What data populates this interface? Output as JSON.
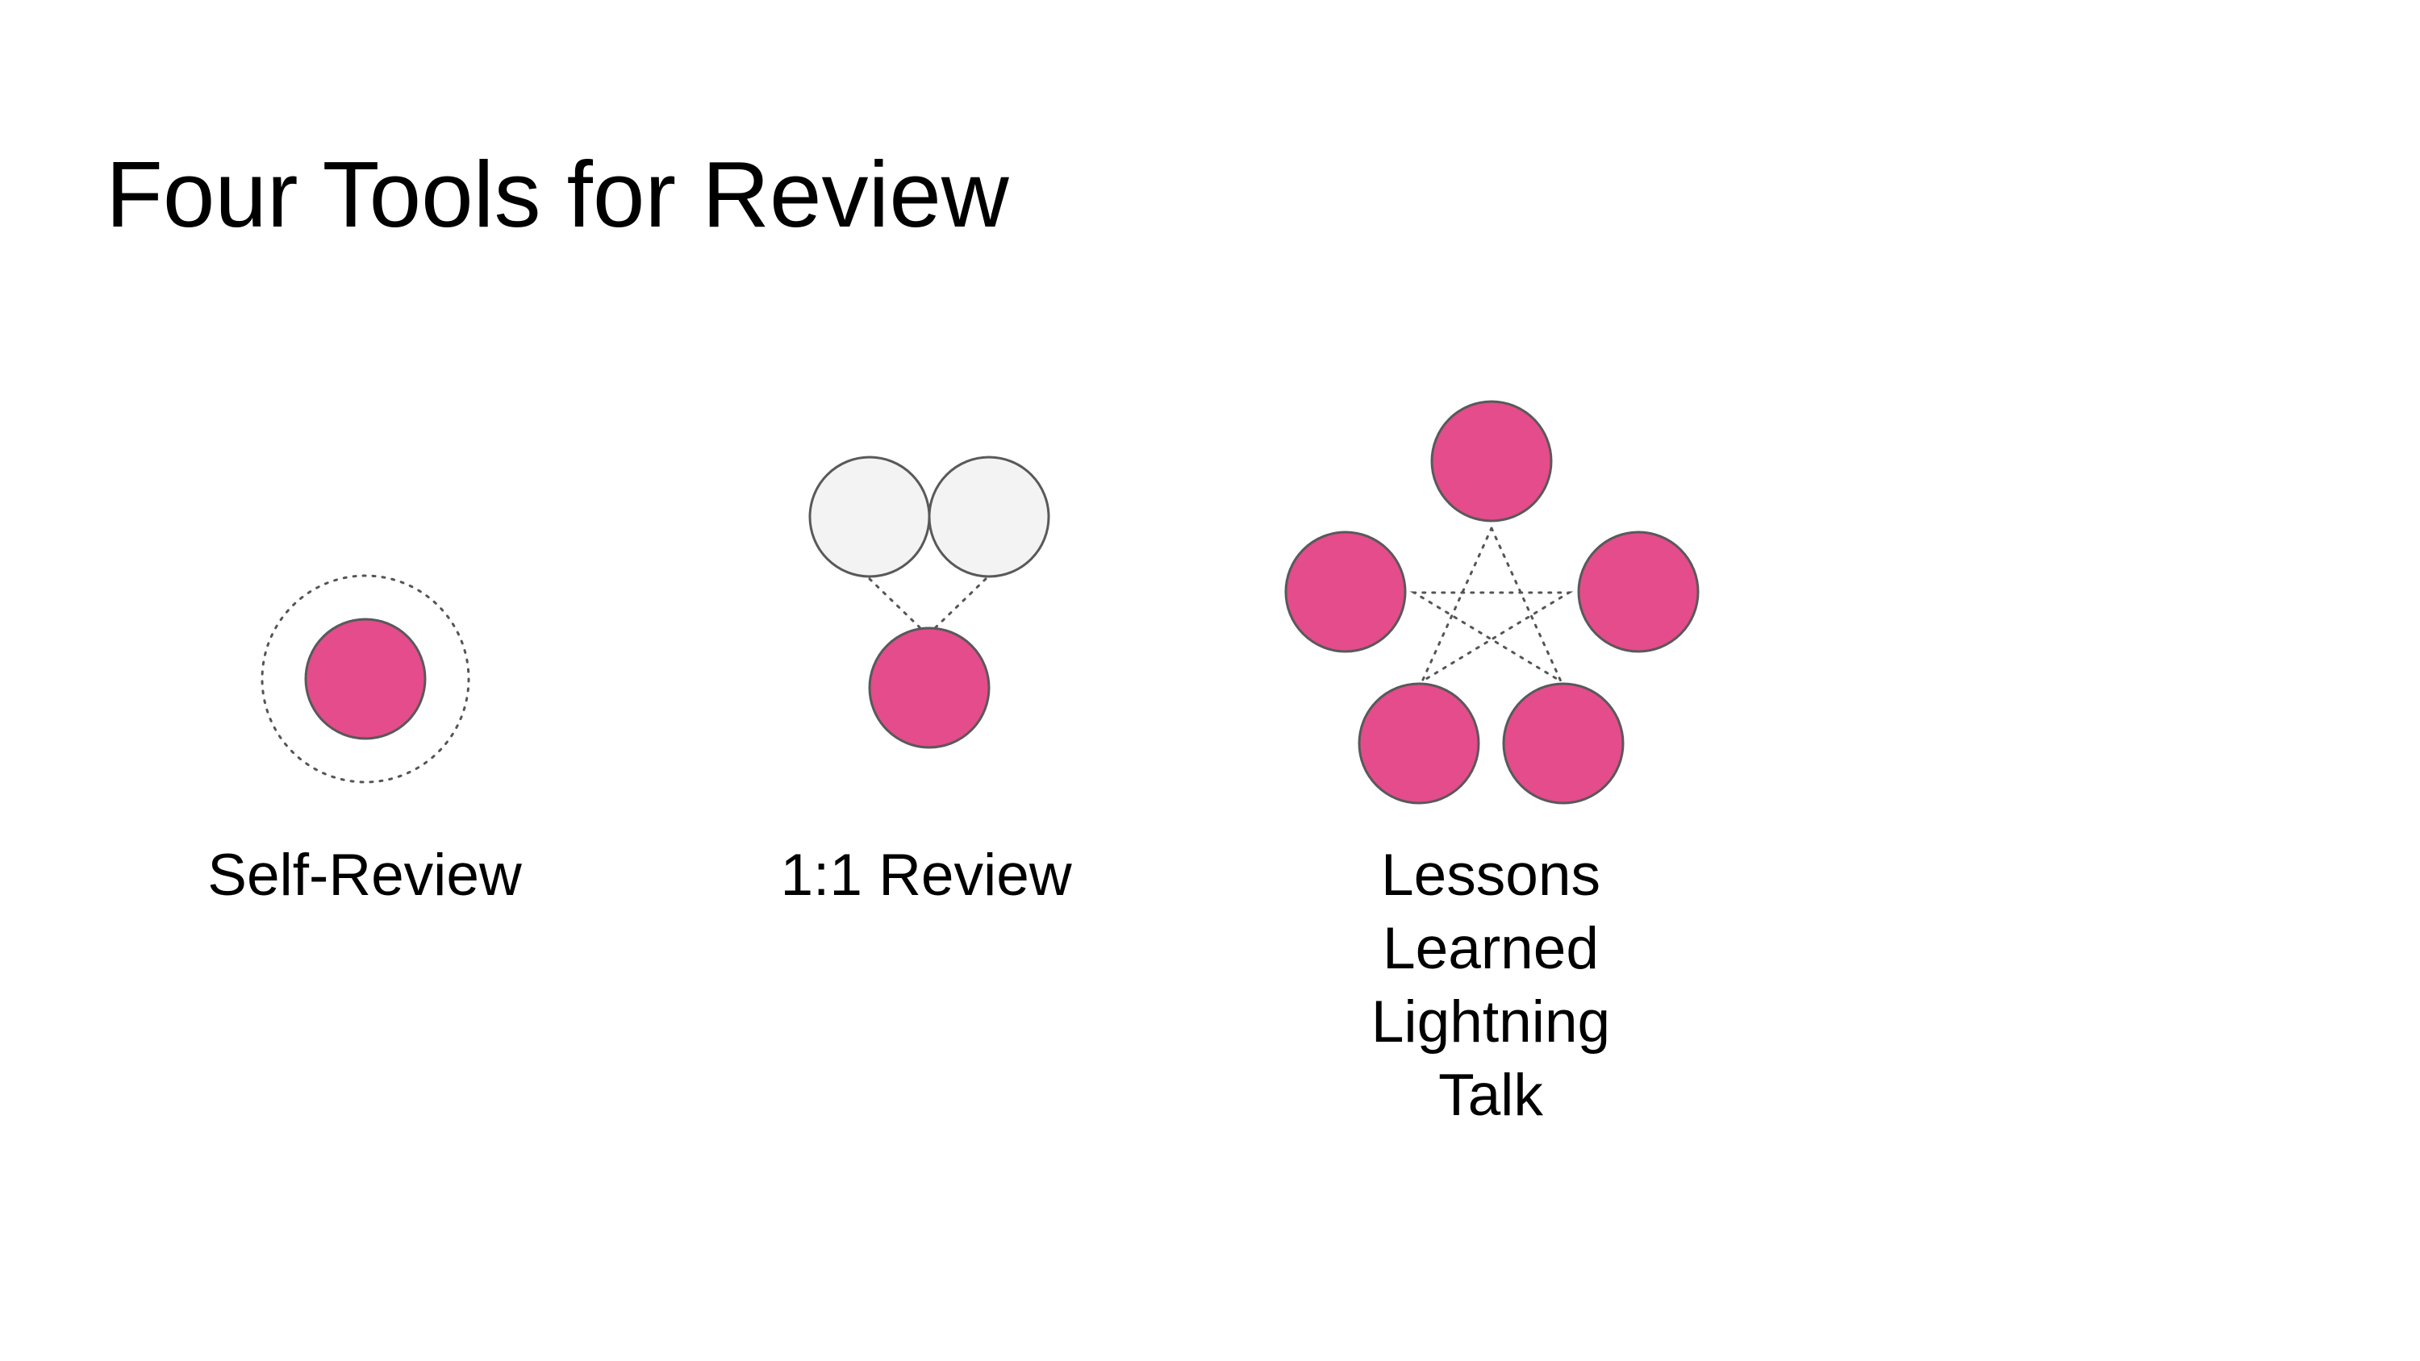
{
  "slide": {
    "title": "Four Tools for Review",
    "colors": {
      "participant_fill": "#e44c8b",
      "peer_fill": "#f3f3f3",
      "node_stroke": "#595959",
      "connector": "#555555"
    }
  },
  "tools": [
    {
      "id": "self",
      "label_lines": [
        "Self-Review"
      ],
      "participants": 1,
      "reviewers": 0
    },
    {
      "id": "one-on-one",
      "label_lines": [
        "1:1 Review"
      ],
      "participants": 1,
      "reviewers": 2
    },
    {
      "id": "lightning",
      "label_lines": [
        "Lessons",
        "Learned",
        "Lightning",
        "Talk"
      ],
      "participants": 5,
      "reviewers": 0
    }
  ]
}
